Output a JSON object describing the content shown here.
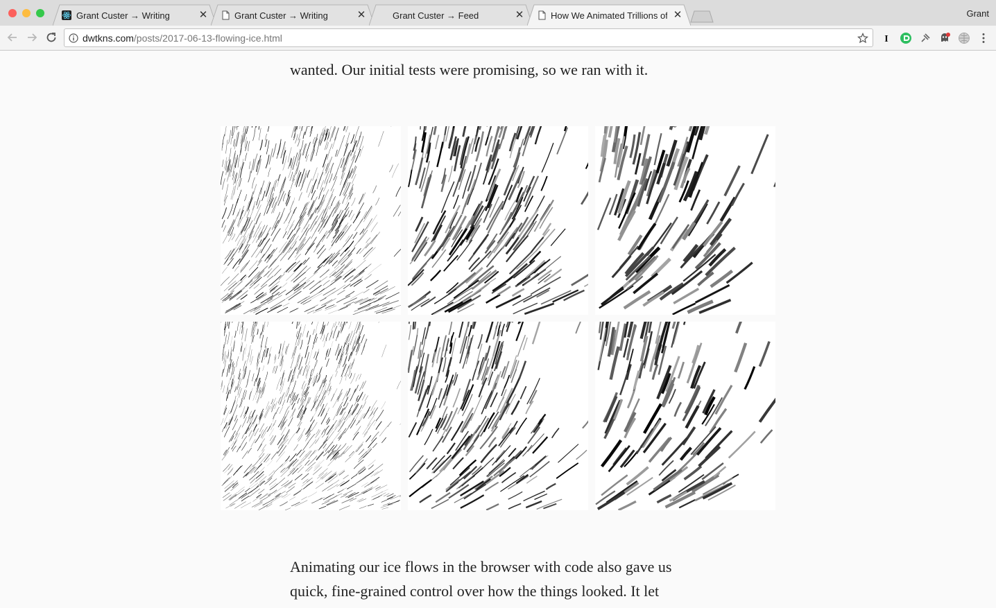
{
  "window": {
    "profile_name": "Grant",
    "traffic_lights": {
      "close": "#fc605c",
      "minimize": "#fdbc40",
      "zoom": "#34c84a"
    }
  },
  "tabs": [
    {
      "title": "Grant Custer → Writing",
      "icon": "react-logo-icon",
      "active": false
    },
    {
      "title": "Grant Custer → Writing",
      "icon": "document-icon",
      "active": false
    },
    {
      "title": "Grant Custer → Feed",
      "icon": "none",
      "active": false
    },
    {
      "title": "How We Animated Trillions of",
      "icon": "document-icon",
      "active": true
    }
  ],
  "toolbar": {
    "url_host": "dwtkns.com",
    "url_path": "/posts/2017-06-13-flowing-ice.html",
    "extensions": [
      "instapaper-icon",
      "evernote-clipper-icon",
      "pin-icon",
      "ghostery-icon",
      "globe-extension-icon"
    ]
  },
  "article": {
    "paragraph_top_line": "wanted. Our initial tests were promising, so we ran with it.",
    "paragraph_bottom_line1": "Animating our ice flows in the browser with code also gave us",
    "paragraph_bottom_line2": "quick, fine-grained control over how the things looked. It let"
  },
  "figure": {
    "description_rows": 2,
    "description_cols": 3,
    "tile_stroke_color": "#111111"
  }
}
